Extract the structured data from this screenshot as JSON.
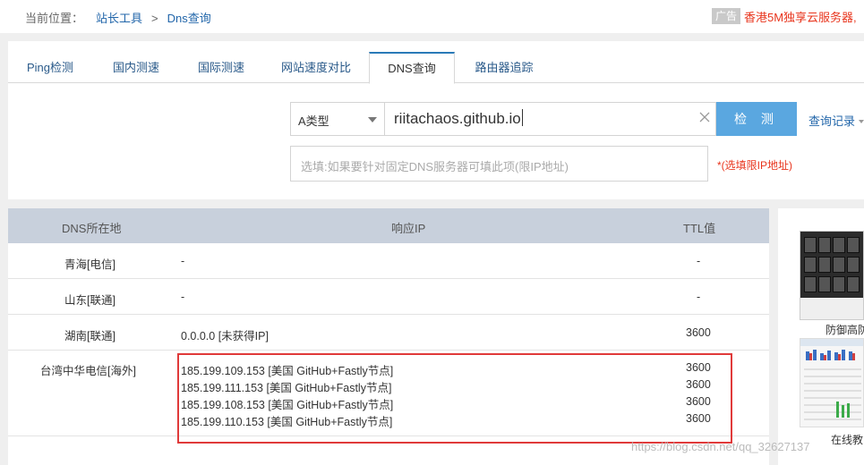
{
  "breadcrumb": {
    "prefix": "当前位置：",
    "items": [
      "站长工具",
      "Dns查询"
    ],
    "separator": ">"
  },
  "ad": {
    "tag": "广告",
    "text": "香港5M独享云服务器,"
  },
  "tabs": [
    {
      "label": "Ping检测",
      "active": false
    },
    {
      "label": "国内测速",
      "active": false
    },
    {
      "label": "国际测速",
      "active": false
    },
    {
      "label": "网站速度对比",
      "active": false
    },
    {
      "label": "DNS查询",
      "active": true
    },
    {
      "label": "路由器追踪",
      "active": false
    }
  ],
  "query": {
    "record_type": "A类型",
    "domain": "riitachaos.github.io",
    "check_button": "检 测",
    "history_link": "查询记录",
    "dns_placeholder": "选填:如果要针对固定DNS服务器可填此项(限IP地址)",
    "dns_note": "*(选填限IP地址)"
  },
  "table": {
    "headers": {
      "location": "DNS所在地",
      "ip": "响应IP",
      "ttl": "TTL值"
    },
    "rows": [
      {
        "location": "青海[电信]",
        "ips": [
          "-"
        ],
        "ttls": [
          "-"
        ]
      },
      {
        "location": "山东[联通]",
        "ips": [
          "-"
        ],
        "ttls": [
          "-"
        ]
      },
      {
        "location": "湖南[联通]",
        "ips": [
          "0.0.0.0 [未获得IP]"
        ],
        "ttls": [
          "3600"
        ]
      },
      {
        "location": "台湾中华电信[海外]",
        "ips": [
          "185.199.109.153 [美国 GitHub+Fastly节点]",
          "185.199.111.153 [美国 GitHub+Fastly节点]",
          "185.199.108.153 [美国 GitHub+Fastly节点]",
          "185.199.110.153 [美国 GitHub+Fastly节点]"
        ],
        "ttls": [
          "3600",
          "3600",
          "3600",
          "3600"
        ]
      }
    ]
  },
  "sidebar": {
    "ad1_caption": "防御高防",
    "ad2_caption": "在线教"
  },
  "watermark": "https://blog.csdn.net/qq_32627137",
  "colors": {
    "link": "#2266aa",
    "accent_button": "#5aa7e0",
    "warning": "#e8341c",
    "highlight_border": "#e03a3a",
    "table_header": "#c8d0dc"
  }
}
